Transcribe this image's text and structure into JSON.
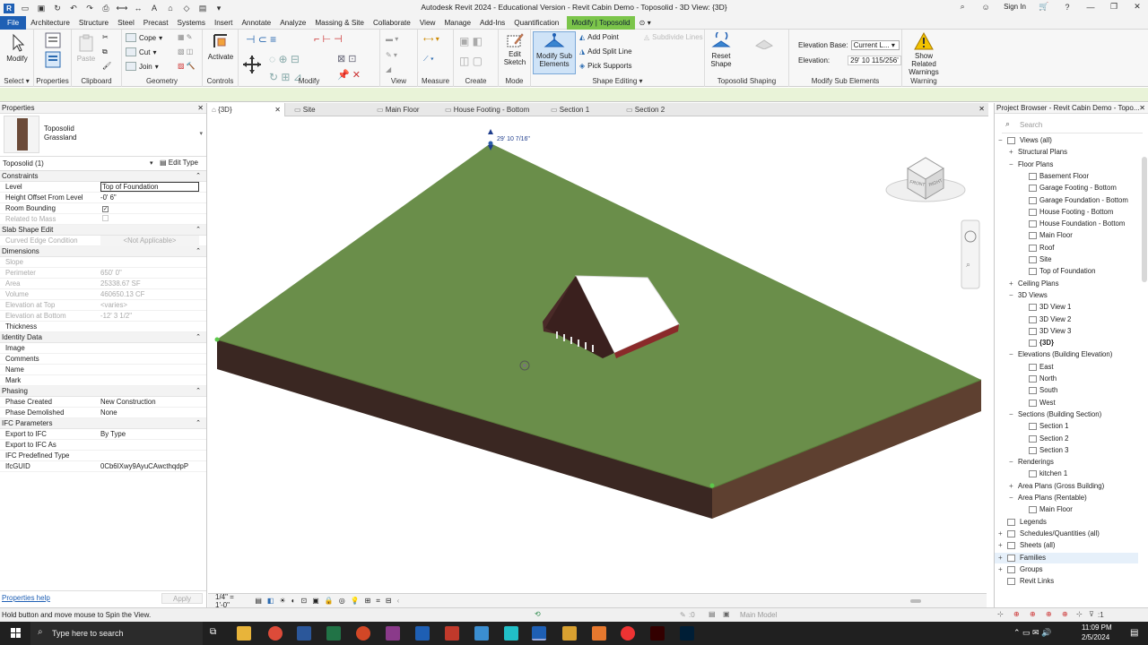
{
  "title": "Autodesk Revit 2024 - Educational Version - Revit Cabin Demo - Toposolid - 3D View: {3D}",
  "sign_in": "Sign In",
  "menu": [
    "File",
    "Architecture",
    "Structure",
    "Steel",
    "Precast",
    "Systems",
    "Insert",
    "Annotate",
    "Analyze",
    "Massing & Site",
    "Collaborate",
    "View",
    "Manage",
    "Add-Ins",
    "Quantification",
    "Modify | Toposolid"
  ],
  "ribbon": {
    "modify": "Modify",
    "select": "Select",
    "properties": "Properties",
    "clipboard": "Clipboard",
    "paste": "Paste",
    "cope": "Cope",
    "cut": "Cut",
    "join": "Join",
    "geometry": "Geometry",
    "activate": "Activate",
    "controls": "Controls",
    "modify_group": "Modify",
    "view": "View",
    "measure": "Measure",
    "create": "Create",
    "edit_sketch": "Edit Sketch",
    "mode": "Mode",
    "modify_sub_elements": "Modify Sub Elements",
    "add_point": "Add Point",
    "add_split_line": "Add Split Line",
    "pick_supports": "Pick Supports",
    "subdivide_lines": "Subdivide Lines",
    "shape_editing": "Shape Editing",
    "reset_shape": "Reset Shape",
    "toposolid_shaping": "Toposolid Shaping",
    "modify_sub_elements_group": "Modify Sub Elements",
    "elevation_base_label": "Elevation Base:",
    "elevation_base_value": "Current L...",
    "elevation_label": "Elevation:",
    "elevation_value": "29'  10 115/256'",
    "show_related_warnings": "Show Related Warnings",
    "warning": "Warning"
  },
  "properties": {
    "header": "Properties",
    "type_name": "Toposolid",
    "type_sub": "Grassland",
    "selector": "Toposolid (1)",
    "edit_type": "Edit Type",
    "sections": [
      {
        "name": "Constraints",
        "rows": [
          {
            "k": "Level",
            "v": "Top of Foundation",
            "dis": false,
            "box": true
          },
          {
            "k": "Height Offset From Level",
            "v": "-0'  6\"",
            "dis": false
          },
          {
            "k": "Room Bounding",
            "v": "",
            "check": true,
            "dis": false
          },
          {
            "k": "Related to Mass",
            "v": "",
            "check": false,
            "dis": true
          }
        ]
      },
      {
        "name": "Slab Shape Edit",
        "rows": [
          {
            "k": "Curved Edge Condition",
            "v": "<Not Applicable>",
            "dis": true,
            "center": true
          }
        ]
      },
      {
        "name": "Dimensions",
        "rows": [
          {
            "k": "Slope",
            "v": "",
            "dis": true
          },
          {
            "k": "Perimeter",
            "v": "650'  0\"",
            "dis": true
          },
          {
            "k": "Area",
            "v": "25338.67 SF",
            "dis": true
          },
          {
            "k": "Volume",
            "v": "460650.13 CF",
            "dis": true
          },
          {
            "k": "Elevation at Top",
            "v": "<varies>",
            "dis": true
          },
          {
            "k": "Elevation at Bottom",
            "v": "-12'  3 1/2\"",
            "dis": true
          },
          {
            "k": "Thickness",
            "v": "",
            "dis": false
          }
        ]
      },
      {
        "name": "Identity Data",
        "rows": [
          {
            "k": "Image",
            "v": "",
            "dis": false
          },
          {
            "k": "Comments",
            "v": "",
            "dis": false
          },
          {
            "k": "Name",
            "v": "",
            "dis": false
          },
          {
            "k": "Mark",
            "v": "",
            "dis": false
          }
        ]
      },
      {
        "name": "Phasing",
        "rows": [
          {
            "k": "Phase Created",
            "v": "New Construction",
            "dis": false
          },
          {
            "k": "Phase Demolished",
            "v": "None",
            "dis": false
          }
        ]
      },
      {
        "name": "IFC Parameters",
        "rows": [
          {
            "k": "Export to IFC",
            "v": "By Type",
            "dis": false
          },
          {
            "k": "Export to IFC As",
            "v": "",
            "dis": false
          },
          {
            "k": "IFC Predefined Type",
            "v": "",
            "dis": false
          },
          {
            "k": "IfcGUID",
            "v": "0Cb6IXwy9AyuCAwcthqdpP",
            "dis": false
          }
        ]
      }
    ],
    "help": "Properties help",
    "apply": "Apply"
  },
  "view_tabs": [
    "{3D}",
    "Site",
    "Main Floor",
    "House Footing - Bottom",
    "Section 1",
    "Section 2"
  ],
  "canvas": {
    "elevation_tag": "29'  10 7/16\"",
    "cube_front": "FRONT",
    "cube_right": "RIGHT"
  },
  "view_bar": {
    "scale": "1/4\" = 1'-0\""
  },
  "browser": {
    "header": "Project Browser - Revit Cabin Demo - Topo...",
    "search": "Search",
    "items": [
      {
        "t": "Views (all)",
        "lvl": 0,
        "exp": "−",
        "icon": true
      },
      {
        "t": "Structural Plans",
        "lvl": 1,
        "exp": "+"
      },
      {
        "t": "Floor Plans",
        "lvl": 1,
        "exp": "−"
      },
      {
        "t": "Basement Floor",
        "lvl": 2
      },
      {
        "t": "Garage Footing - Bottom",
        "lvl": 2
      },
      {
        "t": "Garage Foundation - Bottom",
        "lvl": 2
      },
      {
        "t": "House Footing - Bottom",
        "lvl": 2
      },
      {
        "t": "House Foundation - Bottom",
        "lvl": 2
      },
      {
        "t": "Main Floor",
        "lvl": 2
      },
      {
        "t": "Roof",
        "lvl": 2
      },
      {
        "t": "Site",
        "lvl": 2
      },
      {
        "t": "Top of Foundation",
        "lvl": 2
      },
      {
        "t": "Ceiling Plans",
        "lvl": 1,
        "exp": "+"
      },
      {
        "t": "3D Views",
        "lvl": 1,
        "exp": "−"
      },
      {
        "t": "3D View 1",
        "lvl": 2
      },
      {
        "t": "3D View 2",
        "lvl": 2
      },
      {
        "t": "3D View 3",
        "lvl": 2
      },
      {
        "t": "{3D}",
        "lvl": 2,
        "bold": true
      },
      {
        "t": "Elevations (Building Elevation)",
        "lvl": 1,
        "exp": "−"
      },
      {
        "t": "East",
        "lvl": 2
      },
      {
        "t": "North",
        "lvl": 2
      },
      {
        "t": "South",
        "lvl": 2
      },
      {
        "t": "West",
        "lvl": 2
      },
      {
        "t": "Sections (Building Section)",
        "lvl": 1,
        "exp": "−"
      },
      {
        "t": "Section 1",
        "lvl": 2
      },
      {
        "t": "Section 2",
        "lvl": 2
      },
      {
        "t": "Section 3",
        "lvl": 2
      },
      {
        "t": "Renderings",
        "lvl": 1,
        "exp": "−"
      },
      {
        "t": "kitchen 1",
        "lvl": 2
      },
      {
        "t": "Area Plans (Gross Building)",
        "lvl": 1,
        "exp": "+"
      },
      {
        "t": "Area Plans (Rentable)",
        "lvl": 1,
        "exp": "−"
      },
      {
        "t": "Main Floor",
        "lvl": 2
      },
      {
        "t": "Legends",
        "lvl": 0,
        "icon": true
      },
      {
        "t": "Schedules/Quantities (all)",
        "lvl": 0,
        "exp": "+",
        "icon": true
      },
      {
        "t": "Sheets (all)",
        "lvl": 0,
        "exp": "+",
        "icon": true
      },
      {
        "t": "Families",
        "lvl": 0,
        "exp": "+",
        "icon": true,
        "hl": true
      },
      {
        "t": "Groups",
        "lvl": 0,
        "exp": "+",
        "icon": true
      },
      {
        "t": "Revit Links",
        "lvl": 0,
        "icon": true
      }
    ]
  },
  "status": {
    "text": "Hold button and move mouse to Spin the View.",
    "zero": ":0",
    "model": "Main Model",
    "filter": ":1"
  },
  "taskbar": {
    "search": "Type here to search",
    "time": "11:09 PM",
    "date": "2/5/2024"
  }
}
